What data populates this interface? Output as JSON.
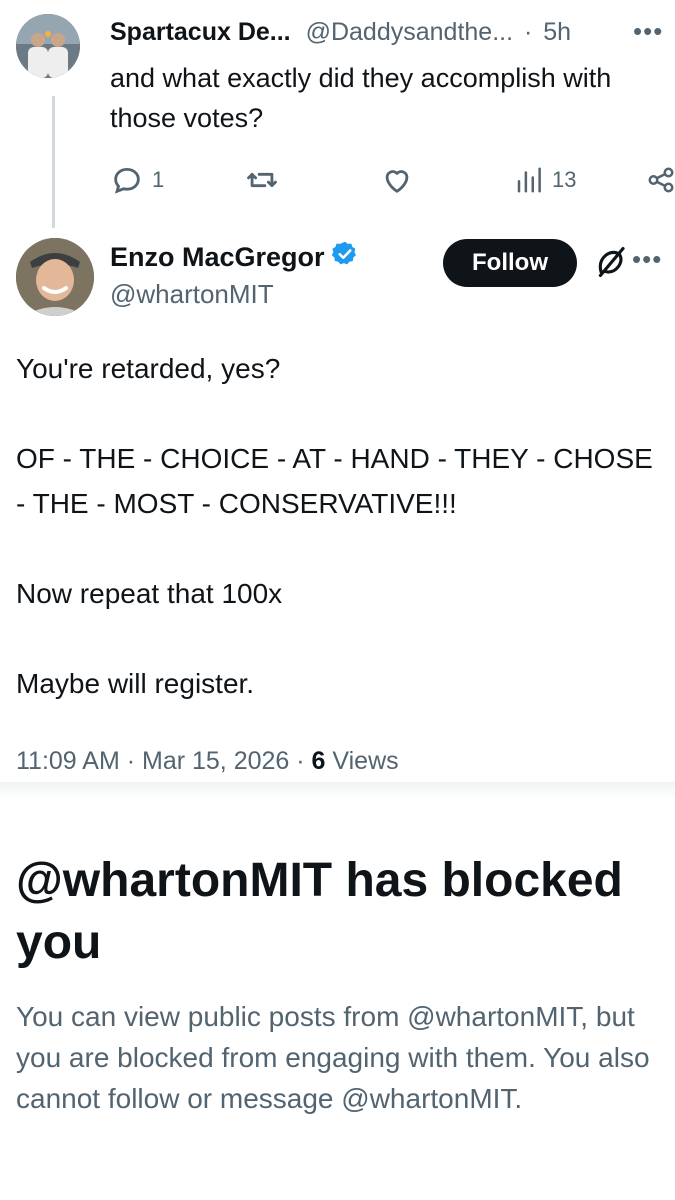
{
  "reply": {
    "name": "Spartacux De...",
    "handle": "@Daddysandthe...",
    "dot": "·",
    "time": "5h",
    "text": "and what exactly did they accomplish with those votes?",
    "replies": "1",
    "views": "13"
  },
  "main": {
    "name": "Enzo MacGregor",
    "handle": "@whartonMIT",
    "follow_label": "Follow",
    "lines": [
      "You're retarded, yes?",
      "OF - THE - CHOICE - AT - HAND - THEY - CHOSE - THE - MOST - CONSERVATIVE!!!",
      "Now repeat that 100x",
      "Maybe will register."
    ],
    "timestamp": "11:09 AM · Mar 15, 2026 · ",
    "views_count": "6",
    "views_label": " Views"
  },
  "blocked": {
    "title": "@whartonMIT has blocked you",
    "description": "You can view public posts from @whartonMIT, but you are blocked from engaging with them. You also cannot follow or message @whartonMIT."
  },
  "colors": {
    "text": "#0f1419",
    "secondary": "#536471",
    "verified": "#1d9bf0",
    "button": "#0f1419"
  },
  "icons": [
    "reply-icon",
    "repost-icon",
    "like-icon",
    "views-icon",
    "share-icon",
    "verified-badge-icon",
    "grok-icon",
    "more-icon"
  ]
}
